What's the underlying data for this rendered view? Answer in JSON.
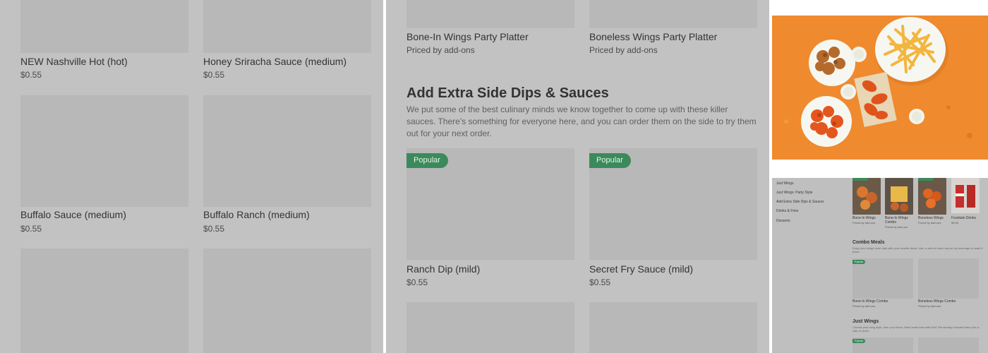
{
  "panel1": {
    "items": [
      {
        "name": "NEW Nashville Hot (hot)",
        "price": "$0.55"
      },
      {
        "name": "Honey Sriracha Sauce (medium)",
        "price": "$0.55"
      },
      {
        "name": "Buffalo Sauce (medium)",
        "price": "$0.55"
      },
      {
        "name": "Buffalo Ranch (medium)",
        "price": "$0.55"
      }
    ]
  },
  "panel2": {
    "top_items": [
      {
        "name": "Bone-In Wings Party Platter",
        "price": "Priced by add-ons"
      },
      {
        "name": "Boneless Wings Party Platter",
        "price": "Priced by add-ons"
      }
    ],
    "section": {
      "title": "Add Extra Side Dips & Sauces",
      "description": "We put some of the best culinary minds we know together to come up with these killer sauces. There's something for everyone here, and you can order them on the side to try them out for your next order."
    },
    "items": [
      {
        "badge": "Popular",
        "name": "Ranch Dip (mild)",
        "price": "$0.55"
      },
      {
        "badge": "Popular",
        "name": "Secret Fry Sauce (mild)",
        "price": "$0.55"
      }
    ]
  },
  "mini": {
    "nav": [
      "Just Wings",
      "Just Wings: Party Style",
      "Add Extra Side Dips & Sauces",
      "Drinks & Fries",
      "Desserts"
    ],
    "top_items": [
      {
        "name": "Bone-In Wings",
        "price": "Priced by add-ons"
      },
      {
        "name": "Bone-In Wings Combo",
        "price": "Priced by add-ons"
      },
      {
        "name": "Boneless Wings",
        "price": "Priced by add-ons"
      },
      {
        "name": "Fountain Drinks",
        "price": "$3.00"
      }
    ],
    "combo": {
      "title": "Combo Meals",
      "description": "Enjoy your wings done right with your favorite flavor, fries, a side of ranch and an icy beverage to wash it down.",
      "badge": "Popular",
      "items": [
        {
          "name": "Bone-In Wings Combo",
          "price": "Priced by add-ons"
        },
        {
          "name": "Boneless Wings Combo",
          "price": "Priced by add-ons"
        }
      ]
    },
    "just_wings": {
      "title": "Just Wings",
      "description": "Choose your wing style, then your flavor. Want some fries with that? We already included them plus a side of ranch.",
      "badge": "Popular"
    }
  },
  "colors": {
    "panel_bg": "#c2c2c2",
    "placeholder": "#b8b8b8",
    "popular_badge": "#3b8a5c",
    "hero_bg": "#ef8a2e"
  }
}
